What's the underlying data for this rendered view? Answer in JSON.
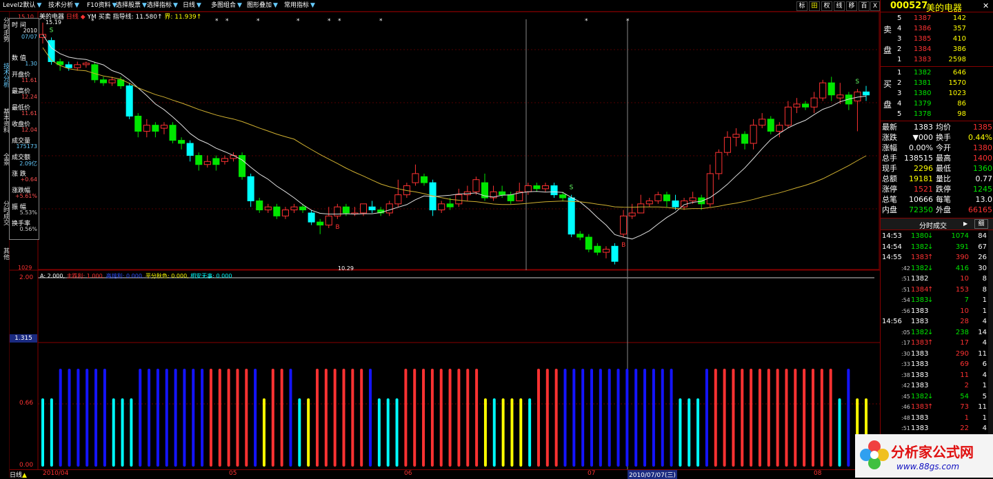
{
  "toolbar": {
    "items": [
      "Level2默认",
      "技术分析",
      "F10资料",
      "选择股票",
      "选择指标",
      "日线",
      "多图组合",
      "图形叠加",
      "常用指标"
    ],
    "right_buttons": [
      "标",
      "田",
      "权",
      "线",
      "移",
      "百",
      "X"
    ]
  },
  "left_tabs": [
    "分时走势",
    "技术分析",
    "基本资料",
    "全景",
    "分时成交",
    "其他"
  ],
  "chart_header": {
    "stock": "美的电器",
    "period": "日线",
    "yw_label": "YM 买卖",
    "indicator_label": "指导线: 11.580↑",
    "indicator_label2": "界: 11.939↑",
    "top_price": "15.10",
    "low_label": "10.29",
    "high_label": "15.19",
    "bottom_price": "1029"
  },
  "data_window": {
    "rows": [
      {
        "label": "时 间",
        "value": "2010"
      },
      {
        "label": "",
        "value": "07/07"
      },
      {
        "label": "数 值",
        "value": "1.30"
      },
      {
        "label": "开盘价",
        "value": "11.61"
      },
      {
        "label": "最高价",
        "value": "12.24"
      },
      {
        "label": "最低价",
        "value": "11.61"
      },
      {
        "label": "收盘价",
        "value": "12.04"
      },
      {
        "label": "成交量",
        "value": "175173"
      },
      {
        "label": "成交额",
        "value": "2.09亿"
      },
      {
        "label": "涨 跌",
        "value": "+0.64"
      },
      {
        "label": "涨跌幅",
        "value": "+5.61%"
      },
      {
        "label": "振 幅",
        "value": "5.53%"
      },
      {
        "label": "换手率",
        "value": "0.56%"
      }
    ]
  },
  "sub_indicator": {
    "title": "A: 2.000,",
    "items": [
      "主跌利: 1.000,",
      "高抛利: 0.000,",
      "平分秋色: 0.000,",
      "相安无事: 0.000"
    ],
    "y_top": "2.00",
    "y_mid": "0.66",
    "y_bottom": "0.00",
    "y_cursor": "1.315"
  },
  "bottom_axis": {
    "tab": "日线",
    "dates": [
      "2010/04",
      "05",
      "06",
      "07",
      "2010/07/07(三)",
      "08"
    ]
  },
  "right_panel": {
    "code": "000527",
    "name": "美的电器",
    "sell_label": [
      "卖",
      "盘"
    ],
    "buy_label": [
      "买",
      "盘"
    ],
    "sells": [
      {
        "n": "5",
        "price": "1387",
        "vol": "142"
      },
      {
        "n": "4",
        "price": "1386",
        "vol": "357"
      },
      {
        "n": "3",
        "price": "1385",
        "vol": "410"
      },
      {
        "n": "2",
        "price": "1384",
        "vol": "386"
      },
      {
        "n": "1",
        "price": "1383",
        "vol": "2598"
      }
    ],
    "buys": [
      {
        "n": "1",
        "price": "1382",
        "vol": "646"
      },
      {
        "n": "2",
        "price": "1381",
        "vol": "1570"
      },
      {
        "n": "3",
        "price": "1380",
        "vol": "1023"
      },
      {
        "n": "4",
        "price": "1379",
        "vol": "86"
      },
      {
        "n": "5",
        "price": "1378",
        "vol": "98"
      }
    ],
    "quote": [
      {
        "l1": "最新",
        "v1": "1383",
        "l2": "均价",
        "v2": "1385"
      },
      {
        "l1": "涨跌",
        "v1": "▼000",
        "l2": "换手",
        "v2": "0.44%"
      },
      {
        "l1": "涨幅",
        "v1": "0.00%",
        "l2": "今开",
        "v2": "1380"
      },
      {
        "l1": "总手",
        "v1": "138515",
        "l2": "最高",
        "v2": "1400"
      },
      {
        "l1": "现手",
        "v1": "2296",
        "l2": "最低",
        "v2": "1360"
      },
      {
        "l1": "总额",
        "v1": "19181",
        "l2": "量比",
        "v2": "0.77"
      },
      {
        "l1": "涨停",
        "v1": "1521",
        "l2": "跌停",
        "v2": "1245"
      },
      {
        "l1": "总笔",
        "v1": "10666",
        "l2": "每笔",
        "v2": "13.0"
      },
      {
        "l1": "内盘",
        "v1": "72350",
        "l2": "外盘",
        "v2": "66165"
      }
    ],
    "trades_title": "分时成交",
    "trades_btn": "细",
    "trades": [
      {
        "t": "14:53",
        "p": "1380",
        "dir": "down",
        "v": "1074",
        "n": "84"
      },
      {
        "t": "14:54",
        "p": "1382",
        "dir": "down",
        "v": "391",
        "n": "67"
      },
      {
        "t": "14:55",
        "p": "1383",
        "dir": "up",
        "v": "390",
        "n": "26"
      },
      {
        "t": ":42",
        "p": "1382",
        "dir": "down",
        "v": "416",
        "n": "30"
      },
      {
        "t": ":51",
        "p": "1382",
        "dir": "",
        "v": "10",
        "n": "8"
      },
      {
        "t": ":51",
        "p": "1384",
        "dir": "up",
        "v": "153",
        "n": "8"
      },
      {
        "t": ":54",
        "p": "1383",
        "dir": "down",
        "v": "7",
        "n": "1"
      },
      {
        "t": ":56",
        "p": "1383",
        "dir": "",
        "v": "10",
        "n": "1"
      },
      {
        "t": "14:56",
        "p": "1383",
        "dir": "",
        "v": "28",
        "n": "4"
      },
      {
        "t": ":05",
        "p": "1382",
        "dir": "down",
        "v": "238",
        "n": "14"
      },
      {
        "t": ":17",
        "p": "1383",
        "dir": "up",
        "v": "17",
        "n": "4"
      },
      {
        "t": ":30",
        "p": "1383",
        "dir": "",
        "v": "290",
        "n": "11"
      },
      {
        "t": ":33",
        "p": "1383",
        "dir": "",
        "v": "69",
        "n": "6"
      },
      {
        "t": ":38",
        "p": "1383",
        "dir": "",
        "v": "11",
        "n": "4"
      },
      {
        "t": ":42",
        "p": "1383",
        "dir": "",
        "v": "2",
        "n": "1"
      },
      {
        "t": ":45",
        "p": "1382",
        "dir": "down",
        "v": "54",
        "n": "5"
      },
      {
        "t": ":46",
        "p": "1383",
        "dir": "up",
        "v": "73",
        "n": "11"
      },
      {
        "t": ":48",
        "p": "1383",
        "dir": "",
        "v": "1",
        "n": "1"
      },
      {
        "t": ":51",
        "p": "1383",
        "dir": "",
        "v": "22",
        "n": "4"
      }
    ]
  },
  "logo": {
    "title": "分析家公式网",
    "url": "www.88gs.com"
  },
  "colors": {
    "up": "#ff3232",
    "down": "#00e600",
    "cyan": "#00ffff",
    "blue": "#1414ff",
    "yellow": "#ffff00",
    "ma1": "#e0e0e0",
    "ma2": "#d0b030"
  },
  "chart_data": {
    "type": "candlestick",
    "candles": [
      [
        14.7,
        14.8,
        15.19,
        14.5
      ],
      [
        14.6,
        13.9,
        14.7,
        13.8
      ],
      [
        13.9,
        13.8,
        14.0,
        13.6
      ],
      [
        13.8,
        13.7,
        13.9,
        13.6
      ],
      [
        13.7,
        13.8,
        13.9,
        13.6
      ],
      [
        13.8,
        13.85,
        13.9,
        13.7
      ],
      [
        13.8,
        13.3,
        13.9,
        13.2
      ],
      [
        13.3,
        13.2,
        13.4,
        13.1
      ],
      [
        13.2,
        13.3,
        13.4,
        13.1
      ],
      [
        13.3,
        13.1,
        13.4,
        13.0
      ],
      [
        13.1,
        12.1,
        13.2,
        12.0
      ],
      [
        12.1,
        11.6,
        12.2,
        11.4
      ],
      [
        11.6,
        11.8,
        12.0,
        11.4
      ],
      [
        11.8,
        11.6,
        11.9,
        11.4
      ],
      [
        11.7,
        11.8,
        11.9,
        11.5
      ],
      [
        11.8,
        11.3,
        11.9,
        11.2
      ],
      [
        11.3,
        11.2,
        11.4,
        11.0
      ],
      [
        11.2,
        10.8,
        11.3,
        10.6
      ],
      [
        10.8,
        10.5,
        10.9,
        10.3
      ],
      [
        10.5,
        10.6,
        10.8,
        10.4
      ],
      [
        10.7,
        10.5,
        10.8,
        10.3
      ],
      [
        10.6,
        10.7,
        10.8,
        10.5
      ],
      [
        10.7,
        10.8,
        10.9,
        10.6
      ],
      [
        10.8,
        10.1,
        10.9,
        10.0
      ],
      [
        10.1,
        9.3,
        10.2,
        9.1
      ],
      [
        9.3,
        9.0,
        9.4,
        8.9
      ],
      [
        9.0,
        9.1,
        9.2,
        8.9
      ],
      [
        9.1,
        8.8,
        9.2,
        8.7
      ],
      [
        8.8,
        9.0,
        9.1,
        8.7
      ],
      [
        9.0,
        9.1,
        9.2,
        8.9
      ],
      [
        9.1,
        9.0,
        9.2,
        8.9
      ],
      [
        8.9,
        8.6,
        9.0,
        8.5
      ],
      [
        8.6,
        8.5,
        8.7,
        8.2
      ],
      [
        8.5,
        8.8,
        9.1,
        8.4
      ],
      [
        8.8,
        9.1,
        9.2,
        8.7
      ],
      [
        9.1,
        8.9,
        9.2,
        8.8
      ],
      [
        8.9,
        8.9,
        9.1,
        8.8
      ],
      [
        8.9,
        9.2,
        9.2,
        8.8
      ],
      [
        9.1,
        9.0,
        9.3,
        8.9
      ],
      [
        9.0,
        8.9,
        9.1,
        8.8
      ],
      [
        8.9,
        9.2,
        9.3,
        8.8
      ],
      [
        9.2,
        9.5,
        10.0,
        9.1
      ],
      [
        9.5,
        9.8,
        9.9,
        9.4
      ],
      [
        9.9,
        10.2,
        10.5,
        9.8
      ],
      [
        10.1,
        9.9,
        10.2,
        9.8
      ],
      [
        9.9,
        9.0,
        10.0,
        8.8
      ],
      [
        9.0,
        9.2,
        9.3,
        8.9
      ],
      [
        9.2,
        9.1,
        9.4,
        9.0
      ],
      [
        9.2,
        9.5,
        9.7,
        9.1
      ],
      [
        9.5,
        9.6,
        9.8,
        9.3
      ],
      [
        9.6,
        10.0,
        10.1,
        9.5
      ],
      [
        9.9,
        9.4,
        10.2,
        9.3
      ],
      [
        9.4,
        9.6,
        9.8,
        9.3
      ],
      [
        9.6,
        9.5,
        9.8,
        9.4
      ],
      [
        9.5,
        9.3,
        9.6,
        9.2
      ],
      [
        9.3,
        9.6,
        9.9,
        9.3
      ],
      [
        9.6,
        9.8,
        9.9,
        9.5
      ],
      [
        9.8,
        9.7,
        9.9,
        9.6
      ],
      [
        9.7,
        9.8,
        9.9,
        9.6
      ],
      [
        9.8,
        9.5,
        9.9,
        9.4
      ],
      [
        9.5,
        9.4,
        9.6,
        9.3
      ],
      [
        9.4,
        8.2,
        9.5,
        8.1
      ],
      [
        8.2,
        8.1,
        8.3,
        8.0
      ],
      [
        8.1,
        7.7,
        8.2,
        7.6
      ],
      [
        7.8,
        7.6,
        7.9,
        7.5
      ],
      [
        7.6,
        7.7,
        7.8,
        7.4
      ],
      [
        7.8,
        7.3,
        7.9,
        7.2
      ],
      [
        8.2,
        8.8,
        9.0,
        8.1
      ],
      [
        8.8,
        8.9,
        9.2,
        8.7
      ],
      [
        8.9,
        9.2,
        9.5,
        8.9
      ],
      [
        9.2,
        9.3,
        9.4,
        9.1
      ],
      [
        9.3,
        9.5,
        9.6,
        9.2
      ],
      [
        9.5,
        9.3,
        9.6,
        9.1
      ],
      [
        9.3,
        9.1,
        9.5,
        9.0
      ],
      [
        9.1,
        9.3,
        9.4,
        9.0
      ],
      [
        9.3,
        9.4,
        9.6,
        9.2
      ],
      [
        9.4,
        9.2,
        9.5,
        9.0
      ],
      [
        9.2,
        10.2,
        10.5,
        9.1
      ],
      [
        10.2,
        10.9,
        11.0,
        10.0
      ],
      [
        10.9,
        11.4,
        11.6,
        10.8
      ],
      [
        11.4,
        11.5,
        11.7,
        11.1
      ],
      [
        11.5,
        11.2,
        11.6,
        11.0
      ],
      [
        11.2,
        11.8,
        12.0,
        11.0
      ],
      [
        11.8,
        12.0,
        12.2,
        11.7
      ],
      [
        12.0,
        11.6,
        12.1,
        11.5
      ],
      [
        11.6,
        11.8,
        11.9,
        11.4
      ],
      [
        11.8,
        12.4,
        12.6,
        11.7
      ],
      [
        12.4,
        12.5,
        12.7,
        12.2
      ],
      [
        12.5,
        12.4,
        12.6,
        12.3
      ],
      [
        12.4,
        12.7,
        12.9,
        12.2
      ],
      [
        12.7,
        13.2,
        13.3,
        12.6
      ],
      [
        13.2,
        12.8,
        13.4,
        12.6
      ],
      [
        12.7,
        12.8,
        13.2,
        12.5
      ],
      [
        12.8,
        12.5,
        12.9,
        12.3
      ],
      [
        12.6,
        12.9,
        13.0,
        11.6
      ],
      [
        12.9,
        12.8,
        13.1,
        12.6
      ]
    ],
    "ylim": [
      10.29,
      15.19
    ]
  }
}
